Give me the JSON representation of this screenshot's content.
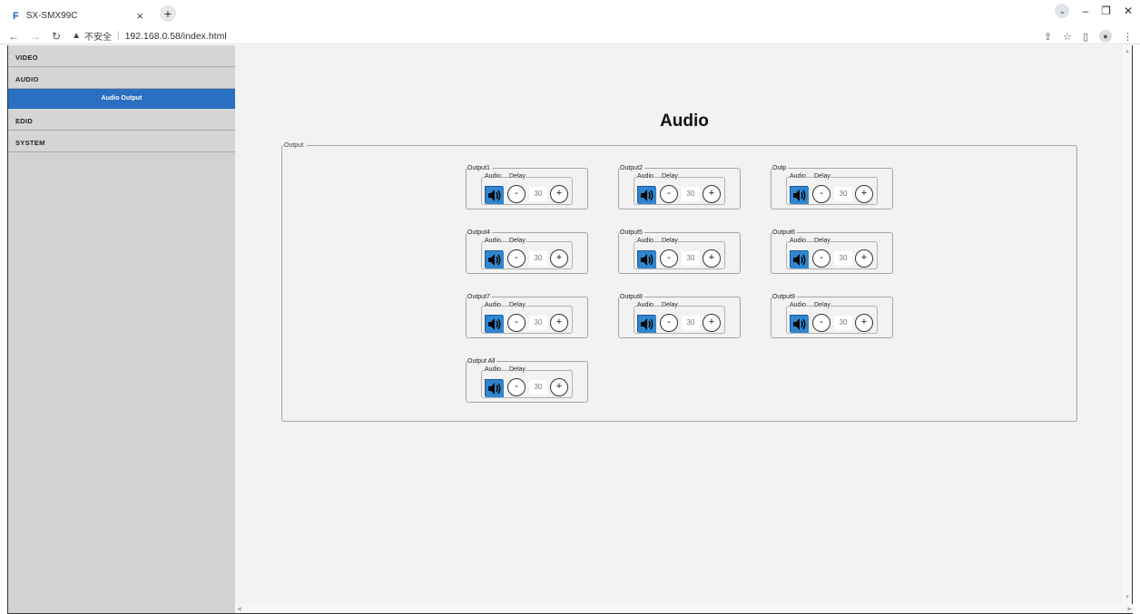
{
  "browser": {
    "tab_title": "SX-SMX99C",
    "favicon_letter": "F",
    "close_glyph": "×",
    "newtab_glyph": "+",
    "security_label": "不安全",
    "url": "192.168.0.58/index.html"
  },
  "sidebar": {
    "items": [
      {
        "label": "VIDEO"
      },
      {
        "label": "AUDIO"
      },
      {
        "label": "EDID"
      },
      {
        "label": "SYSTEM"
      }
    ],
    "active_sub": "Audio Output"
  },
  "main": {
    "title": "Audio",
    "group_label": "Output:",
    "audio_label": "Audio",
    "delay_label": "Delay",
    "minus_label": "-",
    "plus_label": "+",
    "outputs": [
      {
        "name": "Output1",
        "delay": "30"
      },
      {
        "name": "Output2",
        "delay": "30"
      },
      {
        "name": "Outp",
        "delay": "30"
      },
      {
        "name": "Output4",
        "delay": "30"
      },
      {
        "name": "Output5",
        "delay": "30"
      },
      {
        "name": "Output6",
        "delay": "30"
      },
      {
        "name": "Output7",
        "delay": "30"
      },
      {
        "name": "Output8",
        "delay": "30"
      },
      {
        "name": "Output9",
        "delay": "30"
      },
      {
        "name": "Output All",
        "delay": "30"
      }
    ]
  },
  "icons": {
    "speaker": "speaker-icon",
    "back": "back-arrow-icon",
    "forward": "forward-arrow-icon",
    "reload": "reload-icon",
    "warning": "warning-icon",
    "share": "share-icon",
    "star": "star-icon",
    "sidepanel": "side-panel-icon",
    "profile": "profile-icon",
    "menu": "more-menu-icon"
  }
}
